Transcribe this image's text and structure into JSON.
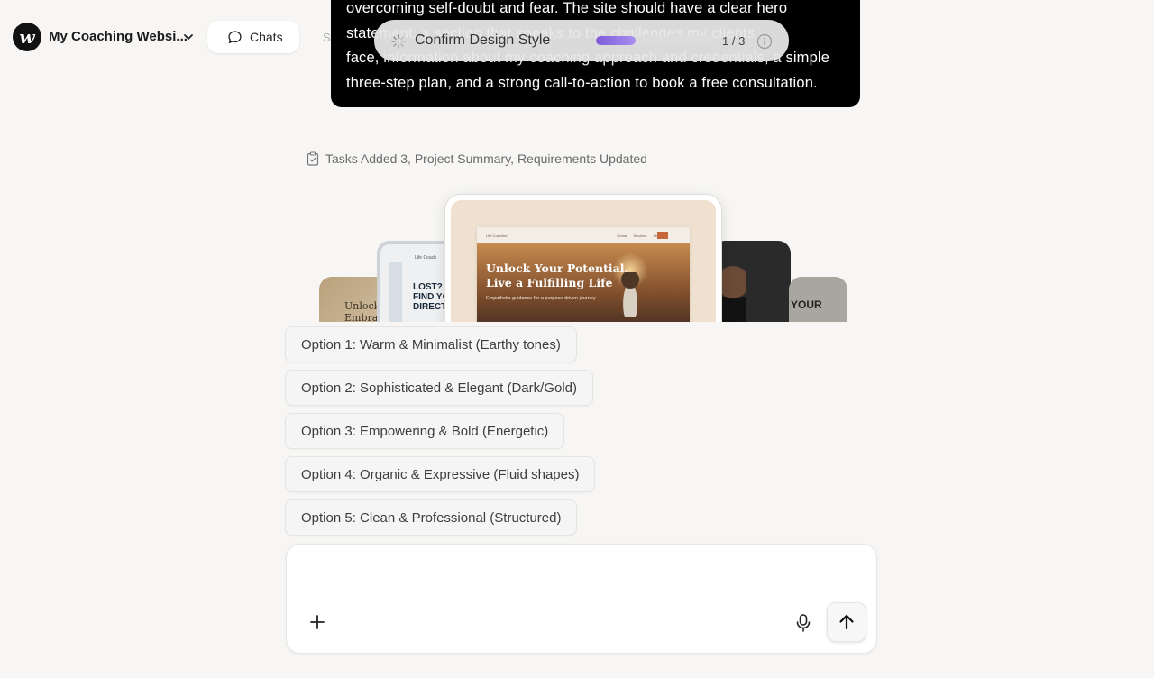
{
  "app": {
    "logo_letter": "w",
    "project_title": "My Coaching Websi...",
    "chats_label": "Chats",
    "hidden_tab_label": "St"
  },
  "message": {
    "text": "overcoming self-doubt and fear. The site should have a clear hero\nstatement, a section that speaks to the challenges my clients\nface, information about my coaching approach and credentials, a simple\nthree-step plan, and a strong call-to-action to book a free consultation."
  },
  "progress": {
    "title": "Confirm Design Style",
    "count": "1 / 3",
    "fraction": 0.33,
    "fill_color": "#8a6ce0"
  },
  "tasks": {
    "text": "Tasks Added 3, Project Summary, Requirements Updated"
  },
  "previews": {
    "card_1_text": "Unlock Y\nEmbrac",
    "card_2_text": "LOST?\nFIND YO\nDIRECTI",
    "card_2_brand": "Life Coach",
    "card_5_text": "YOUR",
    "main": {
      "brand": "Life CoachinG",
      "nav_links": "Home  Services  About",
      "headline_1": "Unlock Your Potential.",
      "headline_2": "Live a Fulfilling Life",
      "subtext": "Empathetic guidance for a purpose-driven journey"
    }
  },
  "options": [
    "Option 1: Warm & Minimalist (Earthy tones)",
    "Option 2: Sophisticated & Elegant (Dark/Gold)",
    "Option 3: Empowering & Bold (Energetic)",
    "Option 4: Organic & Expressive (Fluid shapes)",
    "Option 5: Clean & Professional (Structured)"
  ],
  "composer": {
    "placeholder": ""
  },
  "colors": {
    "background": "#f7f6f4",
    "bubble": "#000000",
    "accent": "#8a6ce0"
  },
  "icons": {
    "logo": "wix-logo-icon",
    "chevron": "chevron-down-icon",
    "chat": "chat-bubble-icon",
    "spinner": "spinner-icon",
    "info": "info-icon",
    "clipboard": "clipboard-icon",
    "plus": "plus-icon",
    "mic": "microphone-icon",
    "send": "arrow-up-icon"
  }
}
